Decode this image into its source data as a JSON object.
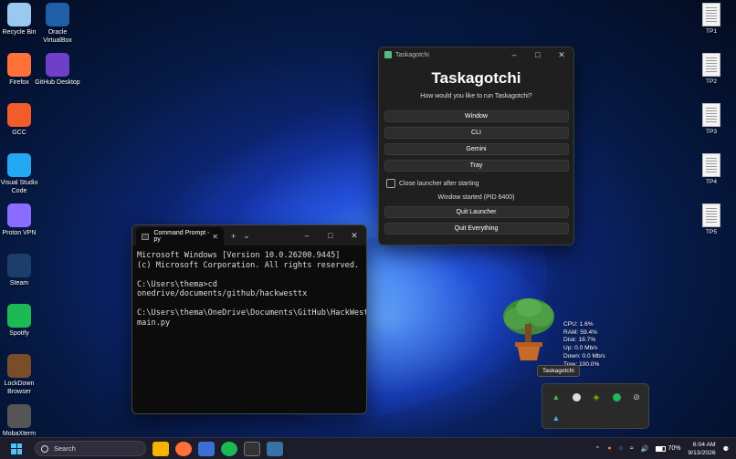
{
  "desktop_icons": [
    {
      "label": "Recycle Bin",
      "icon": "recycle-bin-icon",
      "color": "#9ac9ef"
    },
    {
      "label": "Firefox",
      "icon": "firefox-icon",
      "color": "#ff7139"
    },
    {
      "label": "GCC",
      "icon": "gcc-icon",
      "color": "#f25c2a"
    },
    {
      "label": "Visual Studio Code",
      "icon": "vscode-icon",
      "color": "#23a9f2"
    },
    {
      "label": "Proton VPN",
      "icon": "protonvpn-icon",
      "color": "#8a6cff"
    },
    {
      "label": "Steam",
      "icon": "steam-icon",
      "color": "#1b3f6a"
    },
    {
      "label": "Spotify",
      "icon": "spotify-icon",
      "color": "#1db954"
    },
    {
      "label": "LockDown Browser",
      "icon": "lockdown-icon",
      "color": "#7a4d2a"
    },
    {
      "label": "MobaXterm",
      "icon": "mobaxterm-icon",
      "color": "#555555"
    }
  ],
  "desktop_icons_col2": [
    {
      "label": "Oracle VirtualBox",
      "icon": "virtualbox-icon",
      "color": "#1f5fa8"
    },
    {
      "label": "GitHub Desktop",
      "icon": "github-desktop-icon",
      "color": "#6e40c9"
    }
  ],
  "doc_icons": [
    "TP1",
    "TP2",
    "TP3",
    "TP4",
    "TP5"
  ],
  "launcher": {
    "window_title": "Taskagotchi",
    "heading": "Taskagotchi",
    "prompt": "How would you like to run Taskagotchi?",
    "buttons": [
      "Window",
      "CLI",
      "Gemini",
      "Tray"
    ],
    "checkbox_label": "Close launcher after starting",
    "status": "Window started (PID 6400)",
    "quit_launcher": "Quit Launcher",
    "quit_everything": "Quit Everything"
  },
  "terminal": {
    "tab_title": "Command Prompt - py",
    "output": "Microsoft Windows [Version 10.0.26200.9445]\n(c) Microsoft Corporation. All rights reserved.\n\nC:\\Users\\thema>cd onedrive/documents/github/hackwesttx\n\nC:\\Users\\thema\\OneDrive\\Documents\\GitHub\\HackWestTx>python main.py"
  },
  "pet_stats": {
    "cpu": "CPU: 1.6%",
    "ram": "RAM: 59.4%",
    "disk": "Disk: 18.7%",
    "up": "Up: 0.0 Mb/s",
    "down": "Down: 0.0 Mb/s",
    "tree": "Tree: 100.0%"
  },
  "tray_tooltip": "Taskagotchi",
  "taskbar": {
    "search_placeholder": "Search",
    "battery": "70%",
    "time": "6:04 AM",
    "date": "9/13/2026"
  }
}
